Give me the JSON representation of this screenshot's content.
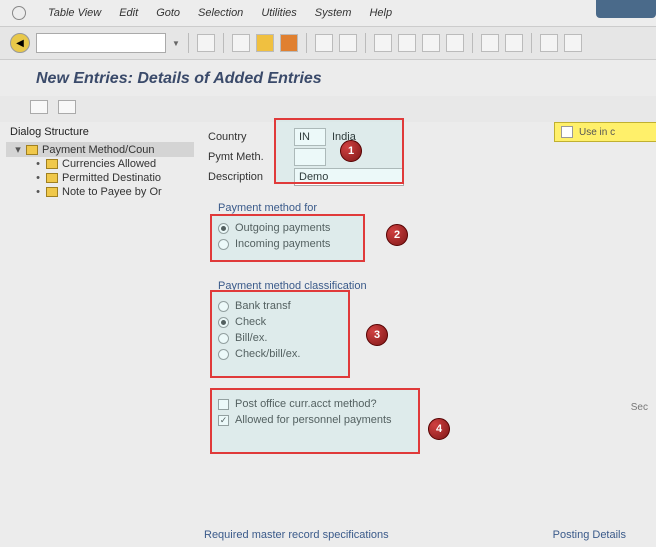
{
  "menubar": {
    "items": [
      "Table View",
      "Edit",
      "Goto",
      "Selection",
      "Utilities",
      "System",
      "Help"
    ]
  },
  "page_title": "New Entries: Details of Added Entries",
  "tree": {
    "title": "Dialog Structure",
    "items": [
      {
        "label": "Payment Method/Coun",
        "level": 1,
        "expanded": true,
        "selected": true
      },
      {
        "label": "Currencies Allowed",
        "level": 2
      },
      {
        "label": "Permitted Destinatio",
        "level": 2
      },
      {
        "label": "Note to Payee by Or",
        "level": 2
      }
    ]
  },
  "form": {
    "country_label": "Country",
    "country_code": "IN",
    "country_name": "India",
    "pm_label": "Pymt Meth.",
    "pm_value": "",
    "desc_label": "Description",
    "desc_value": "Demo"
  },
  "right_box": {
    "label": "Use in c"
  },
  "group_for": {
    "title": "Payment method for",
    "options": [
      {
        "label": "Outgoing payments",
        "checked": true
      },
      {
        "label": "Incoming payments",
        "checked": false
      }
    ]
  },
  "group_class": {
    "title": "Payment method classification",
    "options": [
      {
        "label": "Bank transf",
        "checked": false
      },
      {
        "label": "Check",
        "checked": true
      },
      {
        "label": "Bill/ex.",
        "checked": false
      },
      {
        "label": "Check/bill/ex.",
        "checked": false
      }
    ]
  },
  "group_flags": {
    "options": [
      {
        "label": "Post office curr.acct method?",
        "checked": false
      },
      {
        "label": "Allowed for personnel payments",
        "checked": true
      }
    ]
  },
  "side_label": "Sec",
  "bottom_left": "Required master record specifications",
  "bottom_right": "Posting Details",
  "callouts": [
    "1",
    "2",
    "3",
    "4"
  ]
}
